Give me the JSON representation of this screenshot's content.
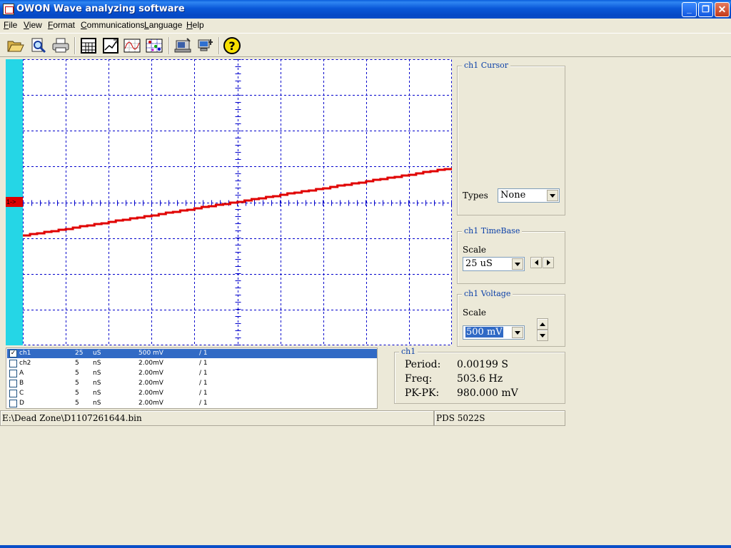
{
  "window": {
    "title": "OWON Wave analyzing software",
    "minimize": "_",
    "restore": "❐",
    "close": "✕"
  },
  "menu": [
    {
      "key": "F",
      "rest": "ile"
    },
    {
      "key": "V",
      "rest": "iew"
    },
    {
      "key": "F",
      "rest": "ormat"
    },
    {
      "key": "C",
      "rest": "ommunications"
    },
    {
      "key": "L",
      "rest": "anguage"
    },
    {
      "key": "H",
      "rest": "elp"
    }
  ],
  "toolbar": {
    "icons": [
      "open-folder-icon",
      "print-preview-icon",
      "print-icon",
      "calculator-icon",
      "measure-icon",
      "waveform-icon",
      "color-grid-icon",
      "scope-download-icon",
      "pc-connect-icon",
      "help-icon"
    ]
  },
  "scope": {
    "channel_marker": "1->",
    "trace_color": "#e00000",
    "grid_color": "#0000cc",
    "strip_color": "#25d6e6"
  },
  "cursor_panel": {
    "title": "ch1 Cursor",
    "types_label": "Types",
    "types_value": "None"
  },
  "timebase_panel": {
    "title": "ch1 TimeBase",
    "scale_label": "Scale",
    "scale_value": "25 uS"
  },
  "voltage_panel": {
    "title": "ch1 Voltage",
    "scale_label": "Scale",
    "scale_value": "500 mV"
  },
  "channels": [
    {
      "name": "ch1",
      "time": "25",
      "tunit": "uS",
      "volt": "500 mV",
      "probe": "/ 1",
      "checked": true,
      "selected": true
    },
    {
      "name": "ch2",
      "time": "5",
      "tunit": "nS",
      "volt": "2.00mV",
      "probe": "/ 1",
      "checked": false,
      "selected": false
    },
    {
      "name": "A",
      "time": "5",
      "tunit": "nS",
      "volt": "2.00mV",
      "probe": "/ 1",
      "checked": false,
      "selected": false
    },
    {
      "name": "B",
      "time": "5",
      "tunit": "nS",
      "volt": "2.00mV",
      "probe": "/ 1",
      "checked": false,
      "selected": false
    },
    {
      "name": "C",
      "time": "5",
      "tunit": "nS",
      "volt": "2.00mV",
      "probe": "/ 1",
      "checked": false,
      "selected": false
    },
    {
      "name": "D",
      "time": "5",
      "tunit": "nS",
      "volt": "2.00mV",
      "probe": "/ 1",
      "checked": false,
      "selected": false
    }
  ],
  "measurements": {
    "title": "ch1",
    "period_label": "Period:",
    "period_value": "0.00199 S",
    "freq_label": "Freq:",
    "freq_value": "503.6 Hz",
    "pkpk_label": "PK-PK:",
    "pkpk_value": "980.000 mV"
  },
  "status": {
    "path": "E:\\Dead Zone\\D1107261644.bin",
    "model": "PDS 5022S"
  }
}
